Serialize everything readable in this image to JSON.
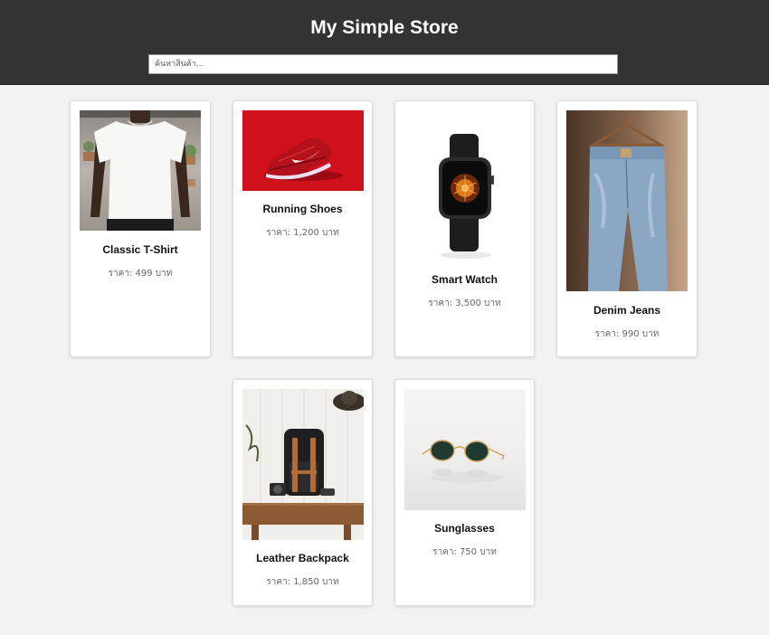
{
  "header": {
    "title": "My Simple Store",
    "search_placeholder": "ค้นหาสินค้า..."
  },
  "products": [
    {
      "name": "Classic T-Shirt",
      "price": "ราคา: 499 บาท",
      "image": "white-tshirt-photo"
    },
    {
      "name": "Running Shoes",
      "price": "ราคา: 1,200 บาท",
      "image": "red-running-shoe-photo"
    },
    {
      "name": "Smart Watch",
      "price": "ราคา: 3,500 บาท",
      "image": "smart-watch-photo"
    },
    {
      "name": "Denim Jeans",
      "price": "ราคา: 990 บาท",
      "image": "denim-jeans-photo"
    },
    {
      "name": "Leather Backpack",
      "price": "ราคา: 1,850 บาท",
      "image": "leather-backpack-photo"
    },
    {
      "name": "Sunglasses",
      "price": "ราคา: 750 บาท",
      "image": "sunglasses-photo"
    }
  ]
}
